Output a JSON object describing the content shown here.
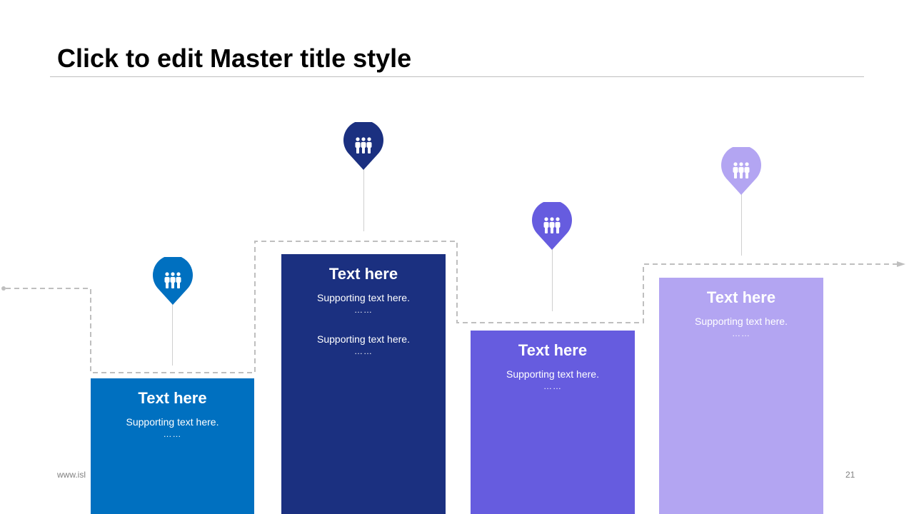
{
  "slide": {
    "title": "Click to edit Master title style",
    "footer_url": "www.isl",
    "page_number": "21"
  },
  "columns": [
    {
      "heading": "Text here",
      "lines": [
        "Supporting text here.",
        "……"
      ],
      "color": "#0070C0",
      "icon": "people-icon"
    },
    {
      "heading": "Text here",
      "lines": [
        "Supporting text here.",
        "……",
        "Supporting text here.",
        "……"
      ],
      "color": "#1B3080",
      "icon": "people-icon"
    },
    {
      "heading": "Text here",
      "lines": [
        "Supporting text here.",
        "……"
      ],
      "color": "#665CDF",
      "icon": "people-icon"
    },
    {
      "heading": "Text here",
      "lines": [
        "Supporting text here.",
        "……"
      ],
      "color": "#B3A5F2",
      "icon": "people-icon"
    }
  ],
  "colors": {
    "path_line": "#BFBFBF",
    "stem": "#CFCFCF"
  }
}
